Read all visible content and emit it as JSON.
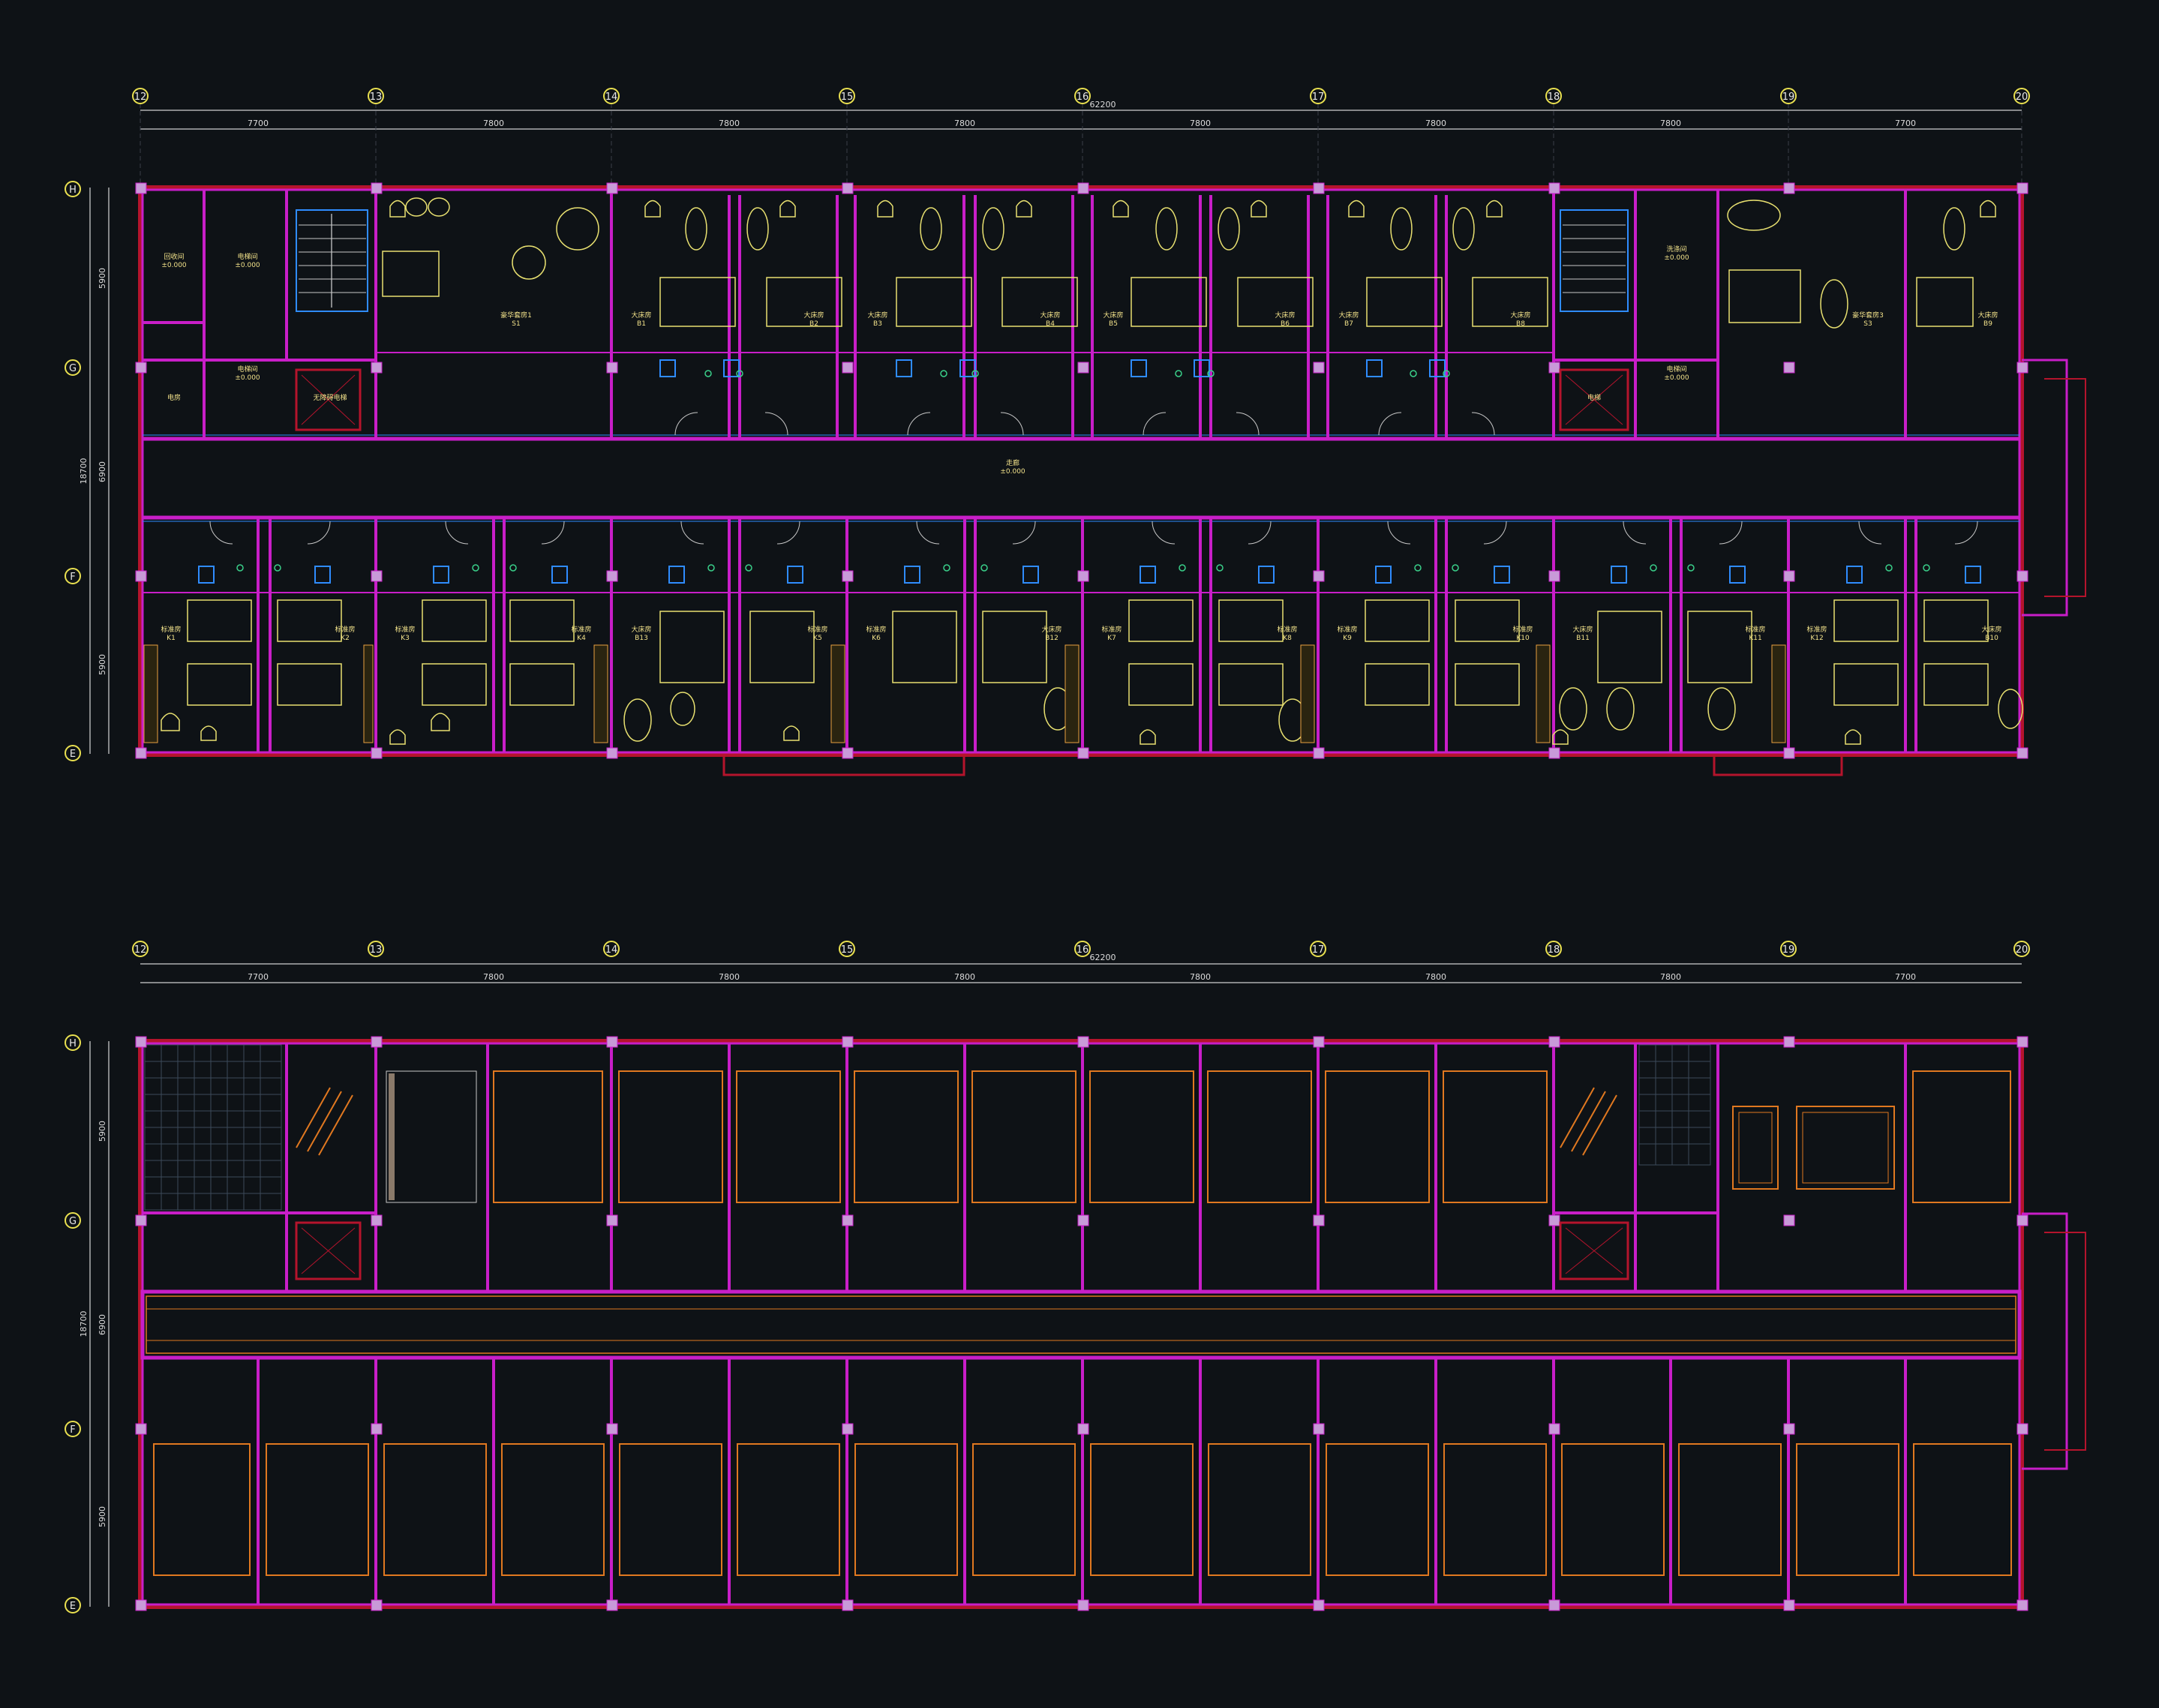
{
  "colors": {
    "background": "#0e1216",
    "wall": "#c81ec8",
    "wall_outer": "#b4142c",
    "column": "#c89ad8",
    "furniture": "#e8e070",
    "fixture": "#2f8cff",
    "ceiling": "#e07820",
    "dimension": "#ffffff",
    "axis_bubble": "#e9e050"
  },
  "plans": [
    {
      "name": "floor-plan",
      "axes_x": [
        "12",
        "13",
        "14",
        "15",
        "16",
        "17",
        "18",
        "19",
        "20"
      ],
      "axes_y": [
        "H",
        "G",
        "F",
        "E"
      ],
      "total_dim": "62200",
      "bay_dims": [
        "7700",
        "7800",
        "7800",
        "7800",
        "7800",
        "7800",
        "7800",
        "7700"
      ],
      "side_total": "18700",
      "side_dims": [
        "5900",
        "6900",
        "5900"
      ],
      "corridor_label": "走廊",
      "corridor_level": "±0.000",
      "north_rooms": [
        {
          "name": "回收间",
          "level": "±0.000"
        },
        {
          "name": "电梯间",
          "level": "±0.000"
        },
        {
          "name": "电梯间",
          "level": "±0.000"
        },
        {
          "name": "电房",
          "level": ""
        },
        {
          "name": "无障碍电梯",
          "level": ""
        },
        {
          "name": "豪华套房1",
          "code": "S1"
        },
        {
          "name": "大床房",
          "code": "B1"
        },
        {
          "name": "大床房",
          "code": "B2"
        },
        {
          "name": "大床房",
          "code": "B3"
        },
        {
          "name": "大床房",
          "code": "B4"
        },
        {
          "name": "大床房",
          "code": "B5"
        },
        {
          "name": "大床房",
          "code": "B6"
        },
        {
          "name": "大床房",
          "code": "B7"
        },
        {
          "name": "大床房",
          "code": "B8"
        },
        {
          "name": "洗涤间",
          "level": "±0.000"
        },
        {
          "name": "电梯间",
          "level": "±0.000"
        },
        {
          "name": "电梯",
          "level": ""
        },
        {
          "name": "豪华套房3",
          "code": "S3"
        },
        {
          "name": "大床房",
          "code": "B9"
        }
      ],
      "south_rooms": [
        {
          "name": "标准房",
          "code": "K1"
        },
        {
          "name": "标准房",
          "code": "K2"
        },
        {
          "name": "标准房",
          "code": "K3"
        },
        {
          "name": "标准房",
          "code": "K4"
        },
        {
          "name": "大床房",
          "code": "B13"
        },
        {
          "name": "标准房",
          "code": "K5"
        },
        {
          "name": "标准房",
          "code": "K6"
        },
        {
          "name": "大床房",
          "code": "B12"
        },
        {
          "name": "标准房",
          "code": "K7"
        },
        {
          "name": "标准房",
          "code": "K8"
        },
        {
          "name": "标准房",
          "code": "K9"
        },
        {
          "name": "标准房",
          "code": "K10"
        },
        {
          "name": "大床房",
          "code": "B11"
        },
        {
          "name": "标准房",
          "code": "K11"
        },
        {
          "name": "标准房",
          "code": "K12"
        },
        {
          "name": "大床房",
          "code": "B10"
        }
      ]
    },
    {
      "name": "ceiling-plan",
      "axes_x": [
        "12",
        "13",
        "14",
        "15",
        "16",
        "17",
        "18",
        "19",
        "20"
      ],
      "axes_y": [
        "H",
        "G",
        "F",
        "E"
      ],
      "total_dim": "62200",
      "bay_dims": [
        "7700",
        "7800",
        "7800",
        "7800",
        "7800",
        "7800",
        "7800",
        "7700"
      ],
      "side_total": "18700",
      "side_dims": [
        "5900",
        "6900",
        "5900"
      ]
    }
  ]
}
